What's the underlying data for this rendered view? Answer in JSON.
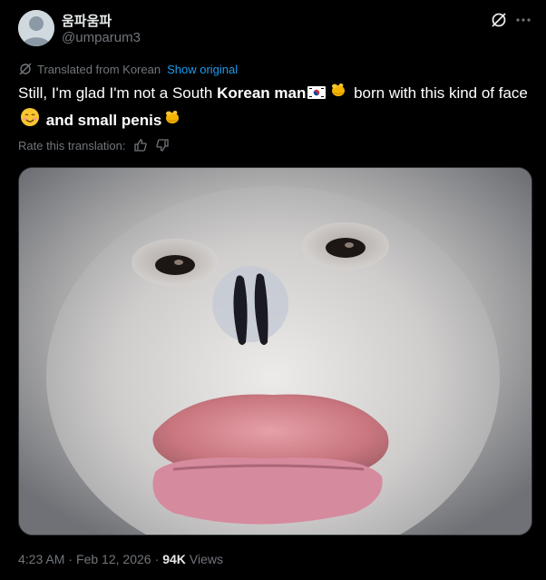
{
  "author": {
    "display_name": "움파움파",
    "handle": "@umparum3"
  },
  "header_icons": [
    "grok-icon",
    "more-icon"
  ],
  "translation": {
    "label": "Translated from Korean",
    "show_original": "Show original"
  },
  "tweet": {
    "line1_part1": "Still, I'm glad I'm not a South ",
    "line1_part2": "Korean man",
    "line1_part3": " born with this kind of face",
    "line2_part1": "and small penis"
  },
  "rate": {
    "label": "Rate this translation:"
  },
  "meta": {
    "time": "4:23 AM",
    "sep1": "·",
    "date": "Feb 12, 2026",
    "sep2": "·",
    "views_count": "94K",
    "views_label": "Views"
  },
  "colors": {
    "background": "#000000",
    "text": "#e7e9ea",
    "muted": "#71767b",
    "link": "#1d9bf0"
  }
}
